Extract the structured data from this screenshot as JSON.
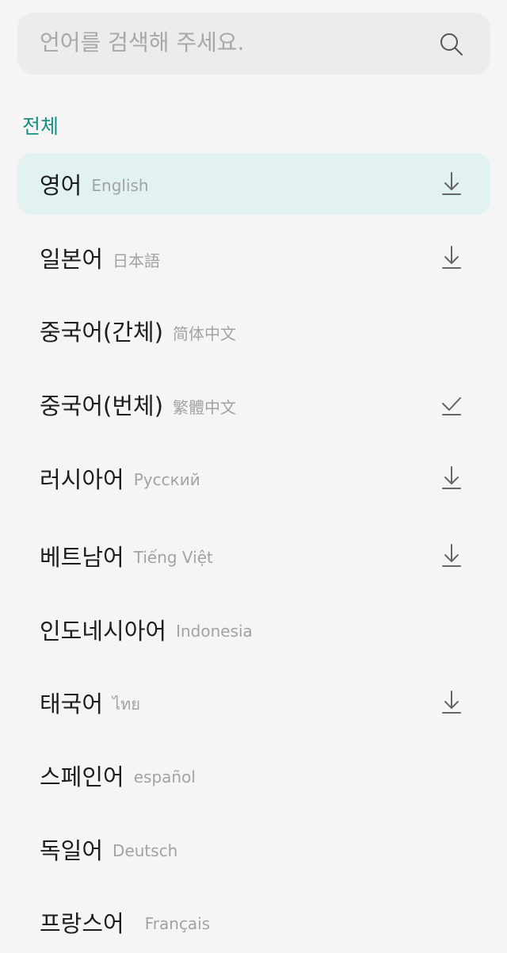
{
  "search": {
    "placeholder": "언어를 검색해 주세요."
  },
  "section_title": "전체",
  "languages": [
    {
      "native": "영어",
      "sub": "English",
      "action": "download-icon",
      "selected": true
    },
    {
      "native": "일본어",
      "sub": "日本語",
      "action": "download-icon"
    },
    {
      "native": "중국어(간체)",
      "sub": "简体中文",
      "action": ""
    },
    {
      "native": "중국어(번체)",
      "sub": "繁體中文",
      "action": "check-icon"
    },
    {
      "native": "러시아어",
      "sub": "Русский",
      "action": "download-icon"
    },
    {
      "native": "베트남어",
      "sub": "Tiếng Việt",
      "action": "download-icon"
    },
    {
      "native": "인도네시아어",
      "sub": "Indonesia",
      "action": ""
    },
    {
      "native": "태국어",
      "sub": "ไทย",
      "action": "download-icon"
    },
    {
      "native": "스페인어",
      "sub": "español",
      "action": ""
    },
    {
      "native": "독일어",
      "sub": "Deutsch",
      "action": ""
    },
    {
      "native": "프랑스어",
      "sub": "Français",
      "action": ""
    }
  ],
  "colors": {
    "accent": "#1a8f84",
    "selected_bg": "#e2f2f1",
    "background": "#f5f5f5"
  }
}
